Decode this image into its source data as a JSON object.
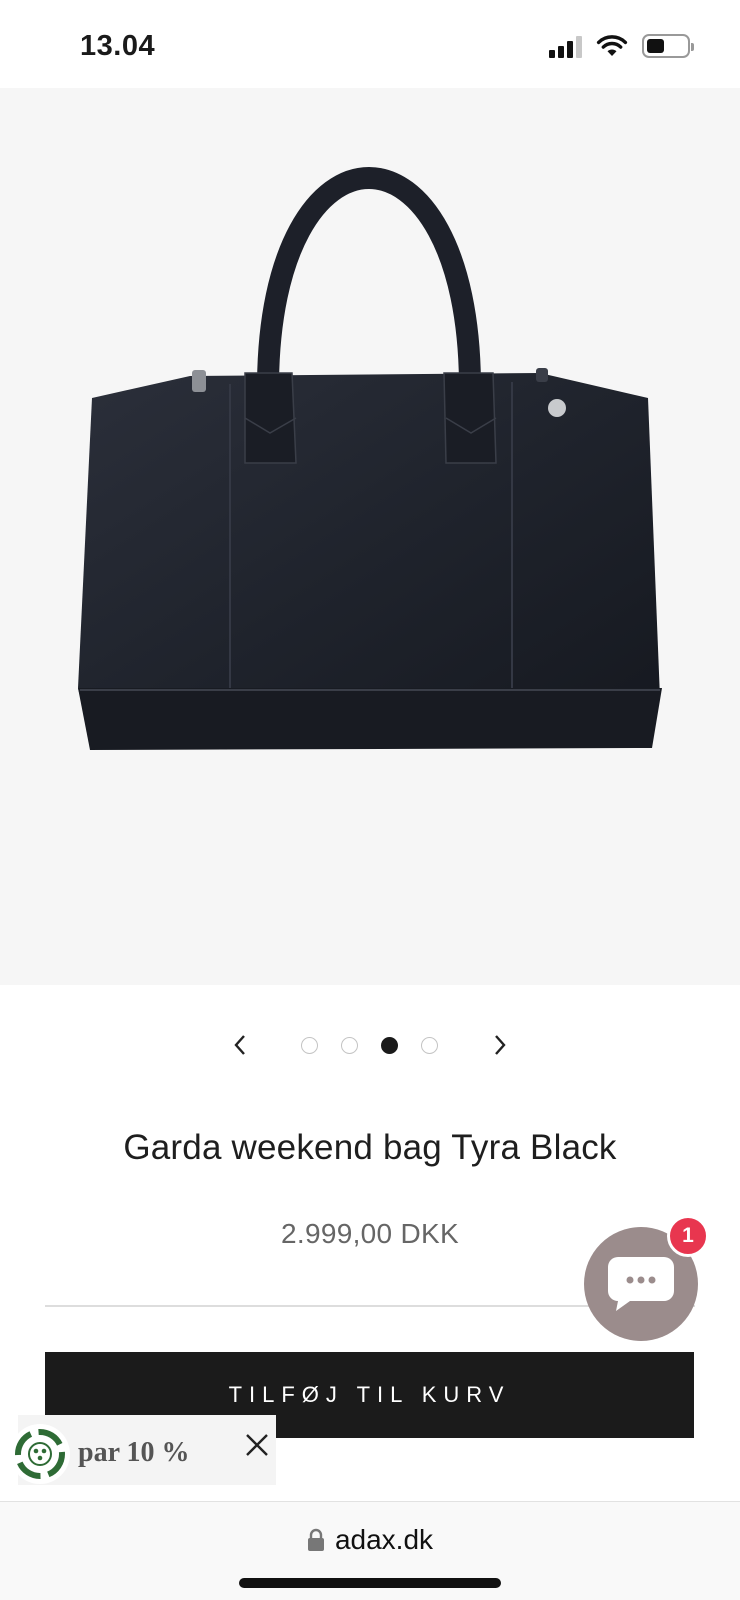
{
  "status_bar": {
    "time": "13.04",
    "battery_percent": 45
  },
  "product": {
    "title": "Garda weekend bag Tyra Black",
    "price": "2.999,00 DKK",
    "image_alt": "Black leather weekend bag"
  },
  "carousel": {
    "prev_icon": "chevron-left-icon",
    "next_icon": "chevron-right-icon",
    "dot_count": 4,
    "active_index": 2
  },
  "cart": {
    "button_label": "TILFØJ TIL KURV"
  },
  "chat": {
    "badge_count": "1"
  },
  "promo": {
    "text": "par 10 %"
  },
  "browser": {
    "url": "adax.dk"
  },
  "colors": {
    "button_bg": "#1b1b1b",
    "chat_bubble": "#9b8c8c",
    "badge": "#e8364f",
    "image_bg": "#f6f6f6"
  }
}
